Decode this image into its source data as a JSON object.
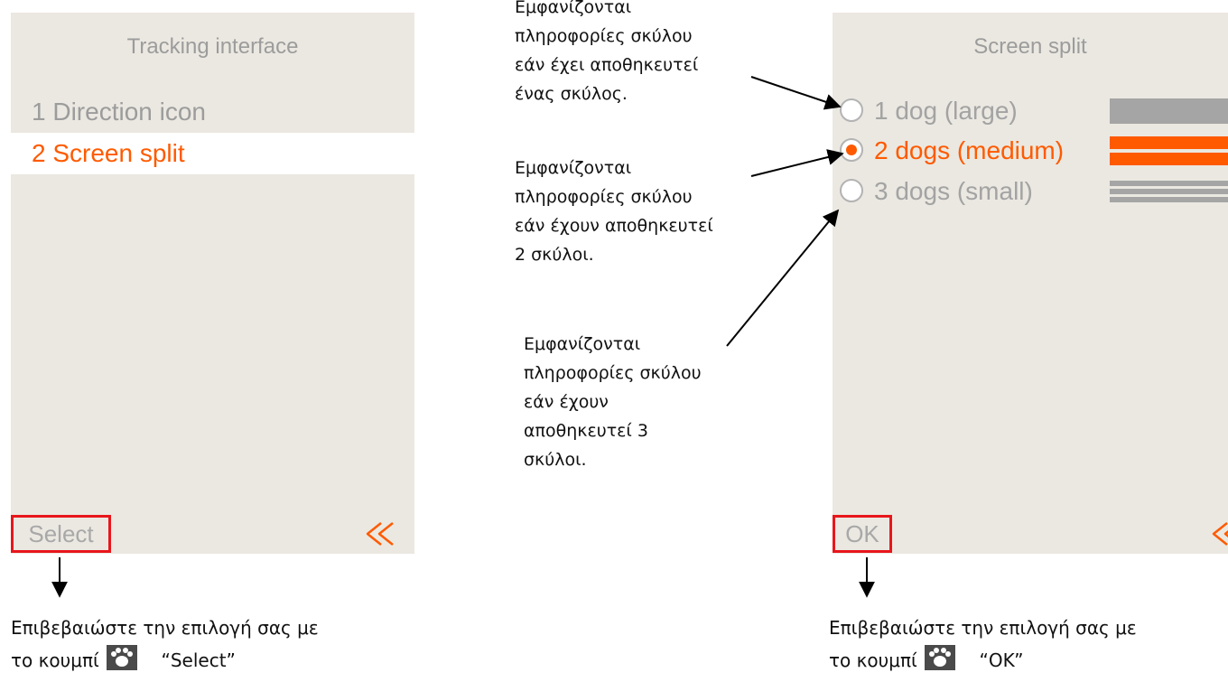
{
  "tracking_screen": {
    "title": "Tracking interface",
    "items": [
      {
        "label": "1 Direction icon",
        "selected": false
      },
      {
        "label": "2 Screen split",
        "selected": true
      }
    ],
    "softkey_label": "Select",
    "back_icon": "double-chevron-left-icon"
  },
  "split_screen": {
    "title": "Screen split",
    "options": [
      {
        "label": "1 dog (large)",
        "checked": false
      },
      {
        "label": "2 dogs (medium)",
        "checked": true
      },
      {
        "label": "3 dogs (small)",
        "checked": false
      }
    ],
    "softkey_label": "OK",
    "back_icon": "double-chevron-left-icon"
  },
  "annotations": {
    "one_dog": [
      "Εμφανίζονται",
      "πληροφορίες σκύλου",
      "εάν έχει αποθηκευτεί",
      "ένας  σκύλος."
    ],
    "two_dogs": [
      "Εμφανίζονται",
      "πληροφορίες σκύλου",
      "εάν έχουν αποθηκευτεί",
      "2 σκύλοι."
    ],
    "three_dogs": [
      "Εμφανίζονται",
      "πληροφορίες σκύλου",
      "εάν έχουν",
      "αποθηκευτεί  3",
      "σκύλοι."
    ]
  },
  "footer_notes": {
    "left": {
      "line1": "Επιβεβαιώστε την επιλογή σας με",
      "line2_prefix": "το κουμπί",
      "button_name": "“Select”"
    },
    "right": {
      "line1": "Επιβεβαιώστε την επιλογή σας με",
      "line2_prefix": "το κουμπί",
      "button_name": "“OK”"
    }
  },
  "colors": {
    "screen_background": "#ebe8e1",
    "accent_orange": "#ff5a00",
    "inactive_text": "#9c9c9c",
    "highlight_box": "#e8161b"
  }
}
